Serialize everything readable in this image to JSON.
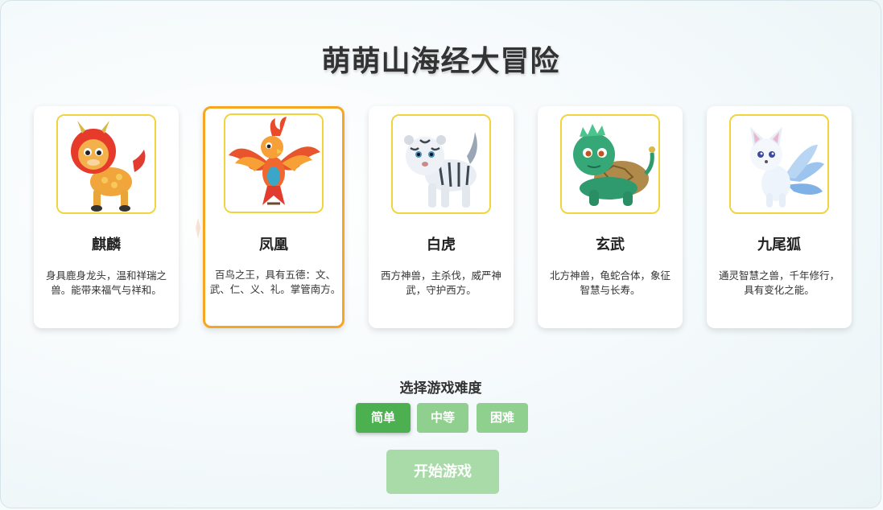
{
  "title": "萌萌山海经大冒险",
  "cards": [
    {
      "name": "麒麟",
      "desc": "身具鹿身龙头，温和祥瑞之兽。能带来福气与祥和。",
      "icon": "qilin-portrait",
      "selected": false
    },
    {
      "name": "凤凰",
      "desc": "百鸟之王，具有五德：文、武、仁、义、礼。掌管南方。",
      "icon": "phoenix-portrait",
      "selected": true
    },
    {
      "name": "白虎",
      "desc": "西方神兽，主杀伐，威严神武，守护西方。",
      "icon": "white-tiger-portrait",
      "selected": false
    },
    {
      "name": "玄武",
      "desc": "北方神兽，龟蛇合体，象征智慧与长寿。",
      "icon": "black-tortoise-portrait",
      "selected": false
    },
    {
      "name": "九尾狐",
      "desc": "通灵智慧之兽，千年修行，具有变化之能。",
      "icon": "nine-tailed-fox-portrait",
      "selected": false
    }
  ],
  "difficulty": {
    "title": "选择游戏难度",
    "options": [
      "简单",
      "中等",
      "困难"
    ],
    "selected": "简单"
  },
  "start_label": "开始游戏",
  "colors": {
    "selected_border": "#f5a623",
    "portrait_border": "#f1d33c",
    "button_active": "#4caf50",
    "button_inactive": "#8fd08f",
    "start_disabled": "#a8dba8"
  }
}
